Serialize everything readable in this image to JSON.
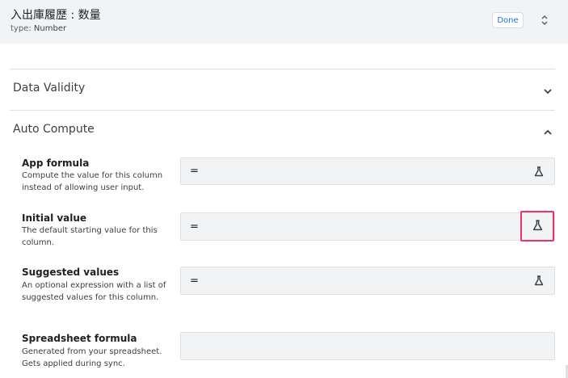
{
  "header": {
    "title": "入出庫履歴 : 数量",
    "type_prefix": "type:",
    "type_value": "Number",
    "done_label": "Done"
  },
  "sections": {
    "data_validity": {
      "label": "Data Validity",
      "icon": "chevron-down-icon"
    },
    "auto_compute": {
      "label": "Auto Compute",
      "icon": "chevron-up-icon"
    }
  },
  "fields": [
    {
      "label": "App formula",
      "description": "Compute the value for this column instead of allowing user input.",
      "value": "=",
      "icon": "flask-icon"
    },
    {
      "label": "Initial value",
      "description": "The default starting value for this column.",
      "value": "=",
      "icon": "flask-icon",
      "highlight_color": "#e8336d"
    },
    {
      "label": "Suggested values",
      "description": "An optional expression with a list of suggested values for this column.",
      "value": "=",
      "icon": "flask-icon"
    },
    {
      "label": "Spreadsheet formula",
      "description": "Generated from your spreadsheet. Gets applied during sync.",
      "value": ""
    }
  ],
  "colors": {
    "accent": "#1a73e8",
    "highlight": "#e8336d",
    "header_bg": "#f1f3f4"
  }
}
